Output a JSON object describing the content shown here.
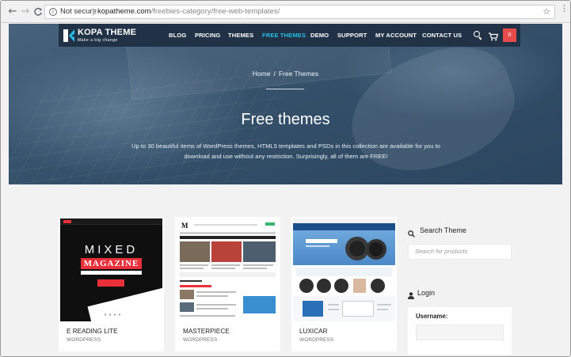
{
  "browser": {
    "security_label": "Not secure",
    "url_host": "kopatheme.com",
    "url_path": "/freebies-category/free-web-templates/",
    "back_glyph": "←",
    "forward_glyph": "→",
    "reload_glyph": "C",
    "info_glyph": "i",
    "star_glyph": "☆",
    "menu_glyph": "⋮"
  },
  "site": {
    "logo_name": "KOPA THEME",
    "logo_tagline": "Make a big change",
    "menu": [
      {
        "label": "BLOG"
      },
      {
        "label": "PRICING"
      },
      {
        "label": "THEMES"
      },
      {
        "label": "FREE THEMES",
        "active": true
      },
      {
        "label": "DEMO"
      },
      {
        "label": "SUPPORT"
      },
      {
        "label": "MY ACCOUNT"
      },
      {
        "label": "CONTACT US"
      }
    ],
    "cart_count": "0",
    "colors": {
      "nav_bg": "#223246",
      "accent": "#23bde8",
      "badge": "#e94b4b"
    }
  },
  "hero": {
    "breadcrumb_home": "Home",
    "breadcrumb_sep": "/",
    "breadcrumb_current": "Free Themes",
    "title": "Free themes",
    "description": "Up to 30 beautiful items of WordPress themes, HTML5 templates and PSDs in this collection are available for you to download and use without any restriction. Surprisingly, all of them are FREE!"
  },
  "thumbs": {
    "mixed_word": "MIXED",
    "magazine_word": "MAGAZINE"
  },
  "cards": [
    {
      "title": "E READING LITE",
      "category": "WORDPRESS"
    },
    {
      "title": "MASTERPIECE",
      "category": "WORDPRESS"
    },
    {
      "title": "LUXICAR",
      "category": "WORDPRESS"
    }
  ],
  "sidebar": {
    "search_title": "Search Theme",
    "search_placeholder": "Search for products",
    "login_title": "Login",
    "username_label": "Username:"
  }
}
